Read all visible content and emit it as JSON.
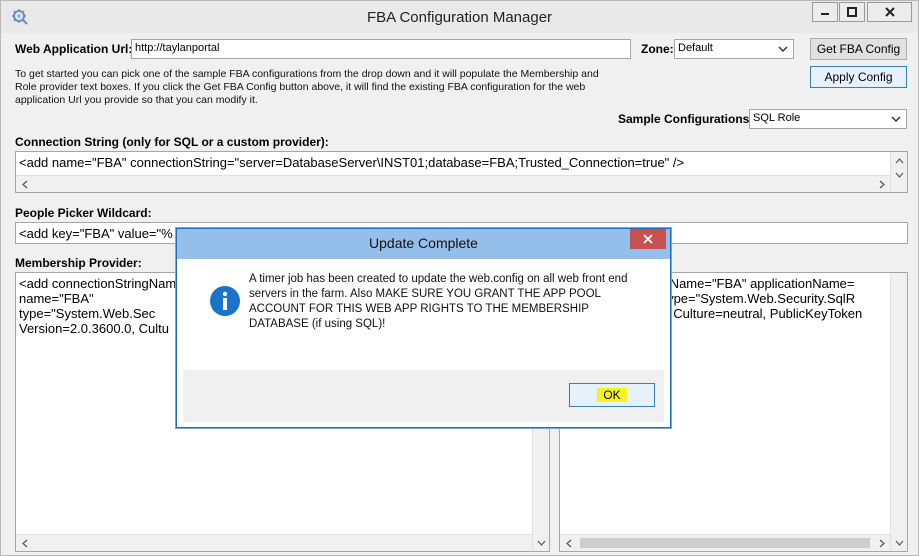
{
  "window": {
    "title": "FBA Configuration Manager",
    "icon": "gear-icon"
  },
  "form": {
    "web_app_url_label": "Web Application Url:",
    "web_app_url_value": "http://taylanportal",
    "zone_label": "Zone:",
    "zone_value": "Default",
    "get_config_label": "Get FBA Config",
    "apply_config_label": "Apply Config",
    "description": "To get started you can pick one of the sample FBA configurations from the drop down and it will populate the Membership and Role provider text boxes.  If you click the Get FBA Config button above, it will find the existing FBA configuration for the web application Url you provide so that you can modify it.",
    "sample_config_label": "Sample Configurations:",
    "sample_config_value": "SQL Role",
    "connection_string_label": "Connection String (only for SQL or a custom provider):",
    "connection_string_value": "<add name=\"FBA\" connectionString=\"server=DatabaseServer\\INST01;database=FBA;Trusted_Connection=true\" />",
    "people_picker_label": "People Picker Wildcard:",
    "people_picker_value": "<add key=\"FBA\" value=\"%",
    "membership_label": "Membership Provider:",
    "membership_lines": [
      "<add connectionStringNam",
      "    name=\"FBA\"",
      "    type=\"System.Web.Sec",
      "    Version=2.0.3600.0, Cultu"
    ],
    "role_lines": [
      "ringName=\"FBA\" applicationName=",
      "e\" type=\"System.Web.Security.SqlR",
      "0.0, Culture=neutral, PublicKeyToken"
    ]
  },
  "dialog": {
    "title": "Update Complete",
    "message": "A timer job has been created to update the web.config on all web front end servers in the farm.  Also MAKE SURE YOU GRANT THE APP POOL ACCOUNT FOR THIS WEB APP RIGHTS TO THE MEMBERSHIP DATABASE (if using SQL)!",
    "ok_label": "OK",
    "icon": "info-icon"
  },
  "colors": {
    "dialog_title_bg": "#94bfea",
    "close_red": "#c75050",
    "info_blue": "#1a73c8",
    "highlight_yellow": "#f5f51d"
  }
}
